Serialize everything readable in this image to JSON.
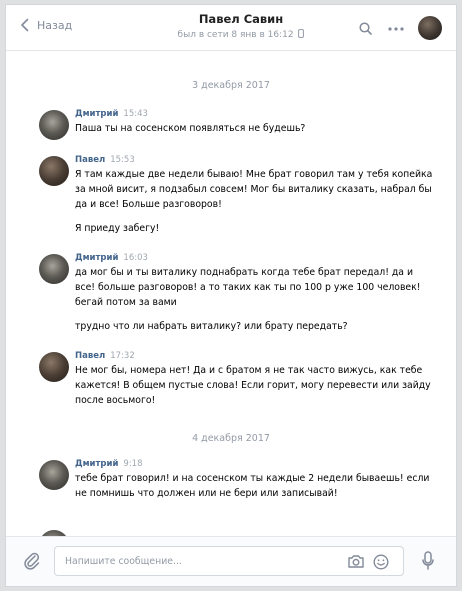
{
  "header": {
    "back_label": "Назад",
    "contact_name": "Павел Савин",
    "last_seen": "был в сети 8 янв в 16:12"
  },
  "messages": [
    {
      "type": "date",
      "text": "3 декабря 2017"
    },
    {
      "type": "msg",
      "author": "Дмитрий",
      "time": "15:43",
      "avatar": "dmitry",
      "paragraphs": [
        "Паша ты на сосенском появляться не будешь?"
      ]
    },
    {
      "type": "msg",
      "author": "Павел",
      "time": "15:53",
      "avatar": "pavel",
      "paragraphs": [
        "Я там каждые две недели бываю! Мне брат говорил там у тебя копейка за мной висит, я подзабыл совсем! Мог бы виталику сказать, набрал бы да и все! Больше разговоров!",
        "Я приеду забегу!"
      ]
    },
    {
      "type": "msg",
      "author": "Дмитрий",
      "time": "16:03",
      "avatar": "dmitry",
      "paragraphs": [
        "да мог бы и ты виталику поднабрать когда тебе брат передал! да и все! больше разговоров! а то таких как ты по 100 р уже 100 человек! бегай потом за вами",
        "трудно что ли набрать виталику? или брату передать?"
      ]
    },
    {
      "type": "msg",
      "author": "Павел",
      "time": "17:32",
      "avatar": "pavel",
      "paragraphs": [
        "Не мог бы, номера нет! Да и с братом я не так часто вижусь, как тебе кажется! В общем пустые слова! Если горит, могу перевести или зайду после восьмого!"
      ]
    },
    {
      "type": "date",
      "text": "4 декабря 2017"
    },
    {
      "type": "msg",
      "author": "Дмитрий",
      "time": "9:18",
      "avatar": "dmitry",
      "paragraphs": [
        "тебе брат говорил! и на сосенском ты каждые 2 недели бываешь! если не помнишь что должен или не бери или записывай!"
      ]
    }
  ],
  "composer": {
    "placeholder": "Напишите сообщение..."
  },
  "icons": {
    "back": "chevron-left-icon",
    "search": "search-icon",
    "more": "more-dots-icon",
    "attach": "paperclip-icon",
    "camera": "camera-icon",
    "emoji": "smile-icon",
    "mic": "microphone-icon"
  }
}
